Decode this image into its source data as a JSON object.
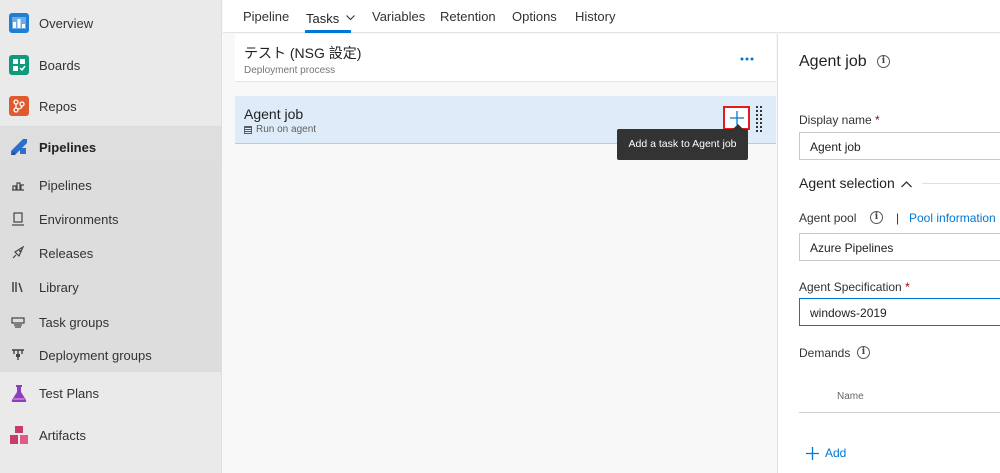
{
  "sidebar": {
    "main_items": [
      {
        "label": "Overview",
        "icon": "overview-icon",
        "color": "#0078d4"
      },
      {
        "label": "Boards",
        "icon": "boards-icon",
        "color": "#009ccc"
      },
      {
        "label": "Repos",
        "icon": "repos-icon",
        "color": "#e05a2f"
      },
      {
        "label": "Pipelines",
        "icon": "pipelines-icon",
        "color": "#2c6ec9"
      },
      {
        "label": "Test Plans",
        "icon": "test-plans-icon",
        "color": "#8a3fbf"
      },
      {
        "label": "Artifacts",
        "icon": "artifacts-icon",
        "color": "#c43e68"
      }
    ],
    "pipeline_sub_items": [
      {
        "label": "Pipelines",
        "icon": "pipelines-sub-icon"
      },
      {
        "label": "Environments",
        "icon": "environments-icon"
      },
      {
        "label": "Releases",
        "icon": "releases-icon"
      },
      {
        "label": "Library",
        "icon": "library-icon"
      },
      {
        "label": "Task groups",
        "icon": "task-groups-icon"
      },
      {
        "label": "Deployment groups",
        "icon": "deployment-groups-icon"
      }
    ]
  },
  "tabs": [
    {
      "label": "Pipeline"
    },
    {
      "label": "Tasks"
    },
    {
      "label": "Variables"
    },
    {
      "label": "Retention"
    },
    {
      "label": "Options"
    },
    {
      "label": "History"
    }
  ],
  "stage": {
    "title": "テスト (NSG 設定)",
    "subtitle": "Deployment process"
  },
  "agent_job": {
    "title": "Agent job",
    "subtitle": "Run on agent",
    "tooltip": "Add a task to Agent job"
  },
  "right_panel": {
    "title": "Agent job",
    "display_name_label": "Display name",
    "display_name_value": "Agent job",
    "agent_selection_label": "Agent selection",
    "agent_pool_label": "Agent pool",
    "pool_info_separator": "|",
    "pool_info_link": "Pool information",
    "agent_pool_value": "Azure Pipelines",
    "agent_spec_label": "Agent Specification",
    "agent_spec_value": "windows-2019",
    "demands_label": "Demands",
    "demands_column": "Name",
    "add_label": "Add",
    "required_marker": "*"
  },
  "colors": {
    "accent": "#0078d4",
    "job_row_bg": "#deecf9",
    "highlight_border": "#e21b1b"
  }
}
